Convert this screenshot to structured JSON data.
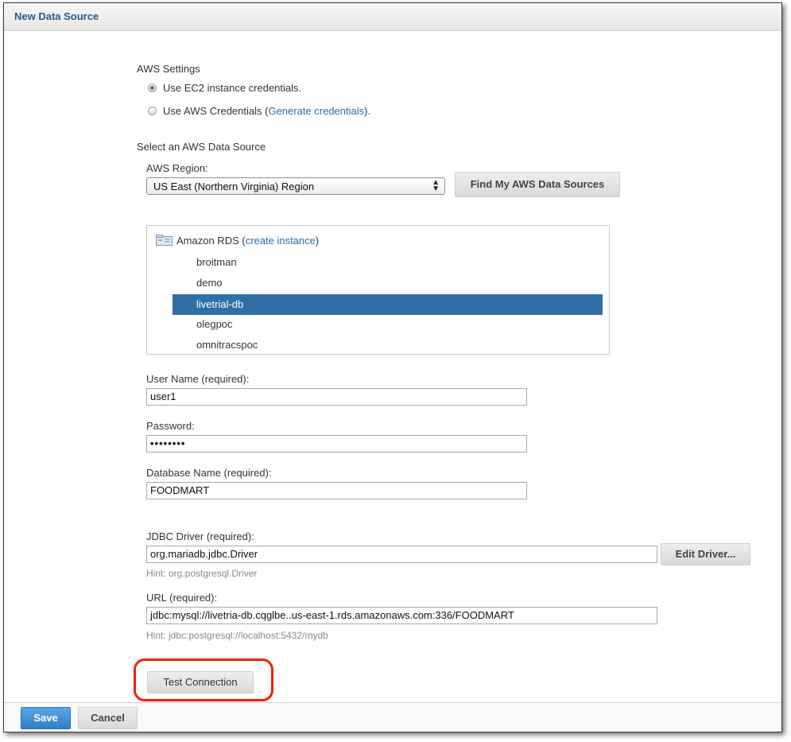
{
  "window": {
    "title": "New Data Source"
  },
  "aws_settings": {
    "heading": "AWS Settings",
    "option_ec2": "Use EC2 instance credentials.",
    "option_aws_prefix": "Use AWS Credentials (",
    "option_aws_link": "Generate credentials",
    "option_aws_suffix": ")."
  },
  "data_source": {
    "heading": "Select an AWS Data Source",
    "region_label": "AWS Region:",
    "region_value": "US East (Northern Virginia) Region",
    "find_button": "Find My AWS Data Sources",
    "tree_root": "Amazon RDS",
    "tree_root_link_prefix": " (",
    "tree_root_link": "create instance",
    "tree_root_link_suffix": ")",
    "instances": [
      "broitman",
      "demo",
      "livetrial-db",
      "olegpoc",
      "omnitracspoc"
    ],
    "selected_instance": "livetrial-db"
  },
  "form": {
    "username_label": "User Name (required):",
    "username_value": "user1",
    "password_label": "Password:",
    "password_value": "••••••••",
    "dbname_label": "Database Name (required):",
    "dbname_value": "FOODMART",
    "jdbc_label": "JDBC Driver (required):",
    "jdbc_value": "org.mariadb.jdbc.Driver",
    "edit_driver_button": "Edit Driver...",
    "jdbc_hint": "Hint: org.postgresql.Driver",
    "url_label": "URL (required):",
    "url_value": "jdbc:mysql://livetria-db.cqglbe..us-east-1.rds.amazonaws.com:336/FOODMART",
    "url_hint": "Hint: jdbc:postgresql://localhost:5432/mydb",
    "test_button": "Test Connection"
  },
  "footer": {
    "save_button": "Save",
    "cancel_button": "Cancel"
  },
  "colors": {
    "title": "#2a5a8a",
    "link": "#2d6ca2",
    "selection": "#2f6fa5",
    "save": "#3d8fd6",
    "highlight": "#ee2200"
  }
}
